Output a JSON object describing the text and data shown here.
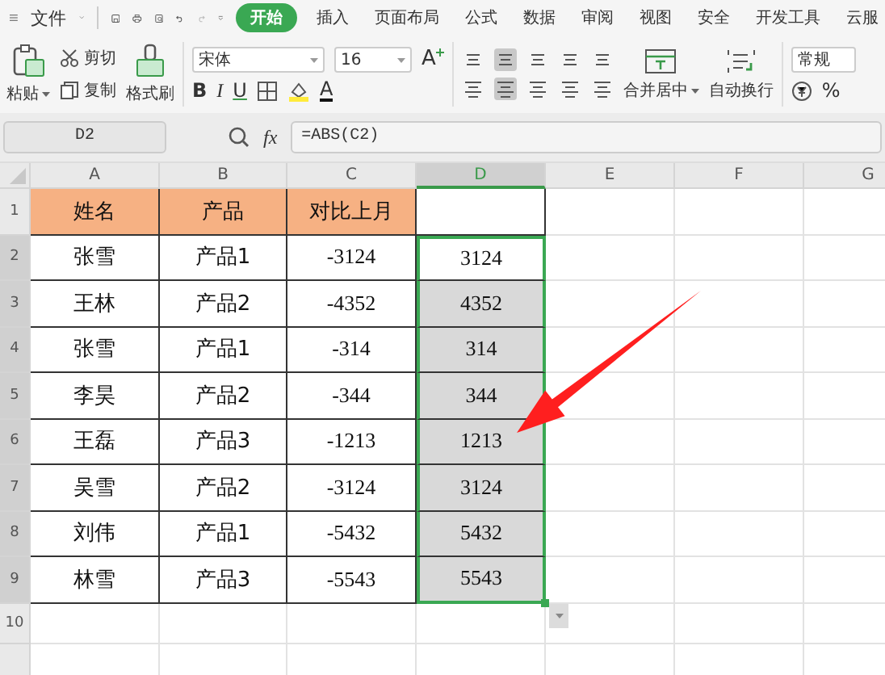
{
  "menu": {
    "file": "文件",
    "tabs": [
      {
        "label": "开始",
        "selected": true
      },
      {
        "label": "插入",
        "selected": false
      },
      {
        "label": "页面布局",
        "selected": false
      },
      {
        "label": "公式",
        "selected": false
      },
      {
        "label": "数据",
        "selected": false
      },
      {
        "label": "审阅",
        "selected": false
      },
      {
        "label": "视图",
        "selected": false
      },
      {
        "label": "安全",
        "selected": false
      },
      {
        "label": "开发工具",
        "selected": false
      },
      {
        "label": "云服",
        "selected": false
      }
    ]
  },
  "ribbon": {
    "paste": "粘贴",
    "cut": "剪切",
    "copy": "复制",
    "format_painter": "格式刷",
    "font": "宋体",
    "font_size": "16",
    "grow": "A",
    "bold": "B",
    "italic": "I",
    "underline": "U",
    "font_color": "A",
    "merge": "合并居中",
    "wrap": "自动换行",
    "number_format": "常规",
    "percent": "%"
  },
  "formula_bar": {
    "name_box": "D2",
    "fx": "fx",
    "formula": "=ABS(C2)"
  },
  "columns": [
    {
      "label": "A",
      "selected": false
    },
    {
      "label": "B",
      "selected": false
    },
    {
      "label": "C",
      "selected": false
    },
    {
      "label": "D",
      "selected": true
    },
    {
      "label": "E",
      "selected": false
    },
    {
      "label": "F",
      "selected": false
    },
    {
      "label": "G",
      "selected": false
    }
  ],
  "rows": [
    {
      "number": "1",
      "kind": "header",
      "selected": false,
      "active": false,
      "cells": [
        "姓名",
        "产品",
        "对比上月"
      ]
    },
    {
      "number": "2",
      "kind": "data",
      "selected": true,
      "active": true,
      "cells": [
        "张雪",
        "产品1",
        "-3124",
        "3124"
      ]
    },
    {
      "number": "3",
      "kind": "data",
      "selected": true,
      "active": false,
      "cells": [
        "王林",
        "产品2",
        "-4352",
        "4352"
      ]
    },
    {
      "number": "4",
      "kind": "data",
      "selected": true,
      "active": false,
      "cells": [
        "张雪",
        "产品1",
        "-314",
        "314"
      ]
    },
    {
      "number": "5",
      "kind": "data",
      "selected": true,
      "active": false,
      "cells": [
        "李昊",
        "产品2",
        "-344",
        "344"
      ]
    },
    {
      "number": "6",
      "kind": "data",
      "selected": true,
      "active": false,
      "cells": [
        "王磊",
        "产品3",
        "-1213",
        "1213"
      ]
    },
    {
      "number": "7",
      "kind": "data",
      "selected": true,
      "active": false,
      "cells": [
        "吴雪",
        "产品2",
        "-3124",
        "3124"
      ]
    },
    {
      "number": "8",
      "kind": "data",
      "selected": true,
      "active": false,
      "cells": [
        "刘伟",
        "产品1",
        "-5432",
        "5432"
      ]
    },
    {
      "number": "9",
      "kind": "data",
      "selected": true,
      "active": false,
      "cells": [
        "林雪",
        "产品3",
        "-5543",
        "5543"
      ]
    },
    {
      "number": "10",
      "kind": "empty",
      "selected": false,
      "active": false,
      "cells": []
    }
  ]
}
